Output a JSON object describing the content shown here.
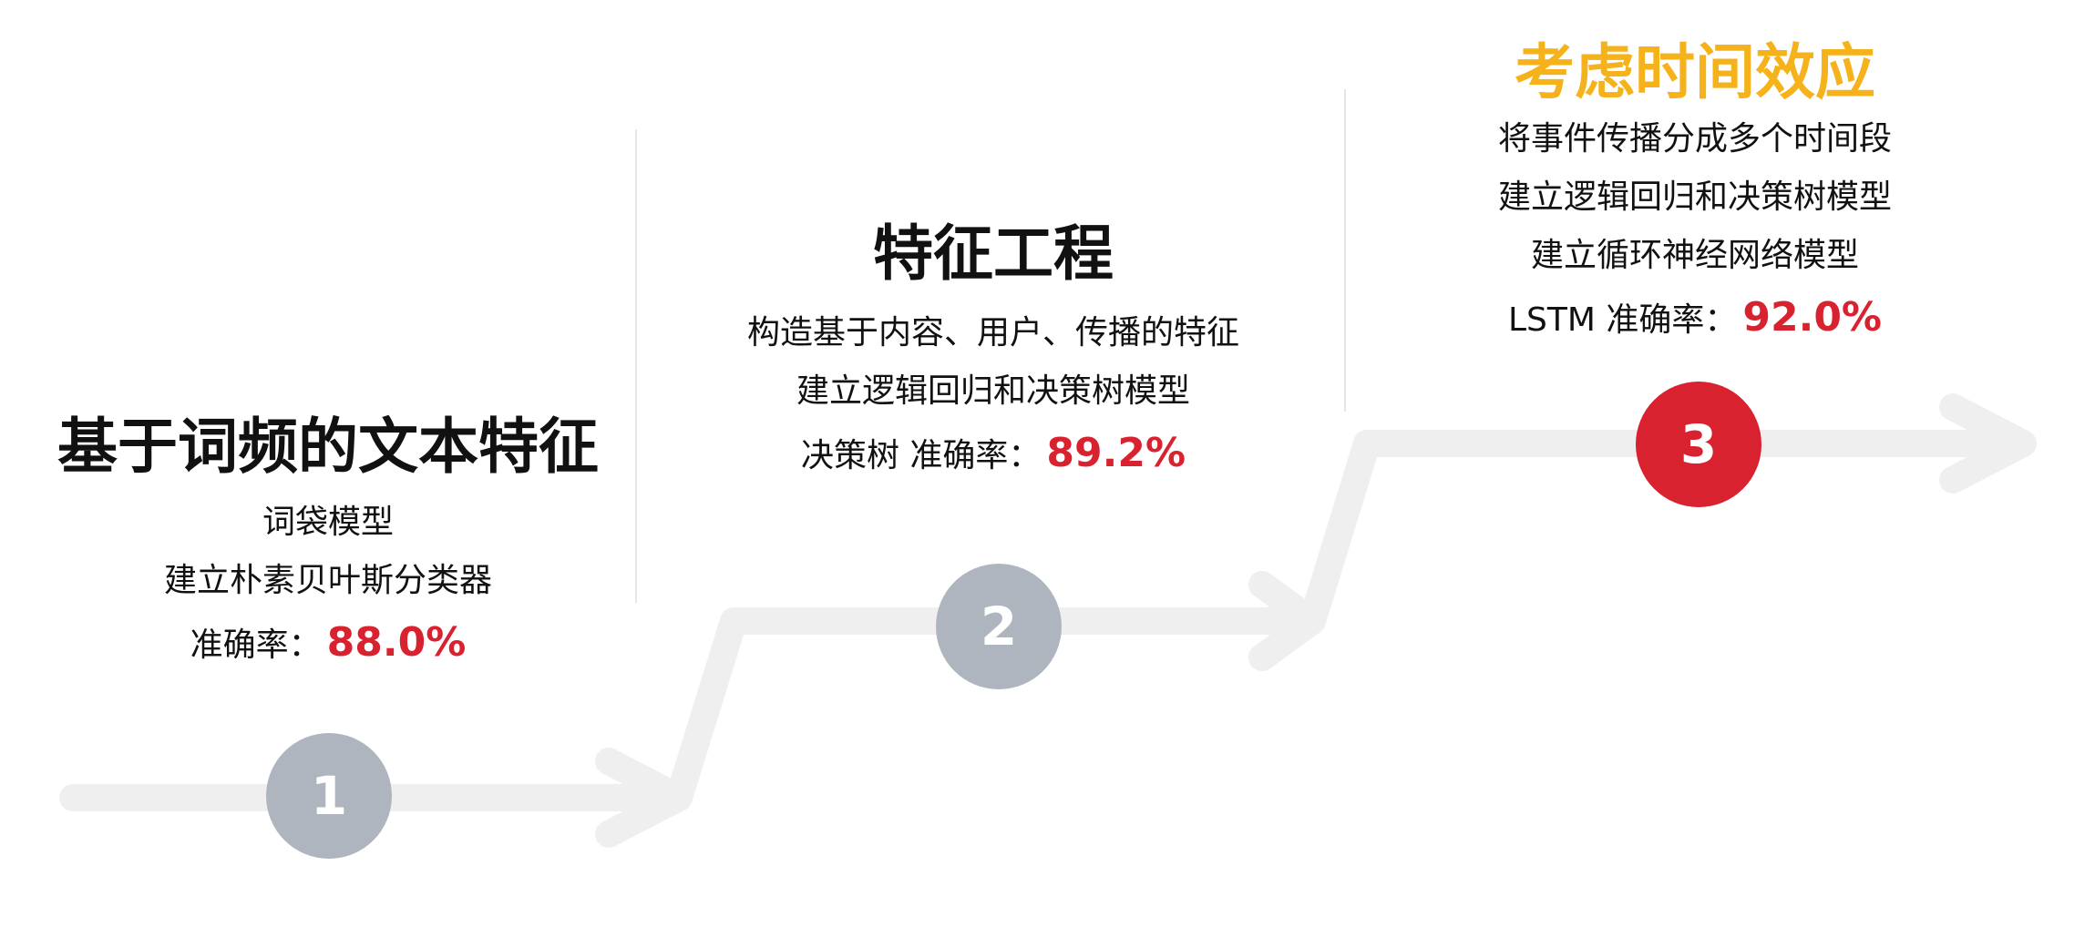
{
  "colors": {
    "path": "#efefef",
    "step_inactive": "#aeb5bf",
    "step_active": "#d9222f",
    "accuracy": "#d9222f",
    "title_default": "#111111",
    "title_highlight": "#f5b21a"
  },
  "stages": [
    {
      "step": "1",
      "title": "基于词频的文本特征",
      "lines": [
        "词袋模型",
        "建立朴素贝叶斯分类器"
      ],
      "acc_label": "准确率：",
      "acc_value": "88.0%",
      "active": false
    },
    {
      "step": "2",
      "title": "特征工程",
      "lines": [
        "构造基于内容、用户、传播的特征",
        "建立逻辑回归和决策树模型"
      ],
      "acc_label": "决策树 准确率：",
      "acc_value": "89.2%",
      "active": false
    },
    {
      "step": "3",
      "title": "考虑时间效应",
      "lines": [
        "将事件传播分成多个时间段",
        "建立逻辑回归和决策树模型",
        "建立循环神经网络模型"
      ],
      "acc_label": "LSTM 准确率：",
      "acc_value": "92.0%",
      "active": true
    }
  ]
}
